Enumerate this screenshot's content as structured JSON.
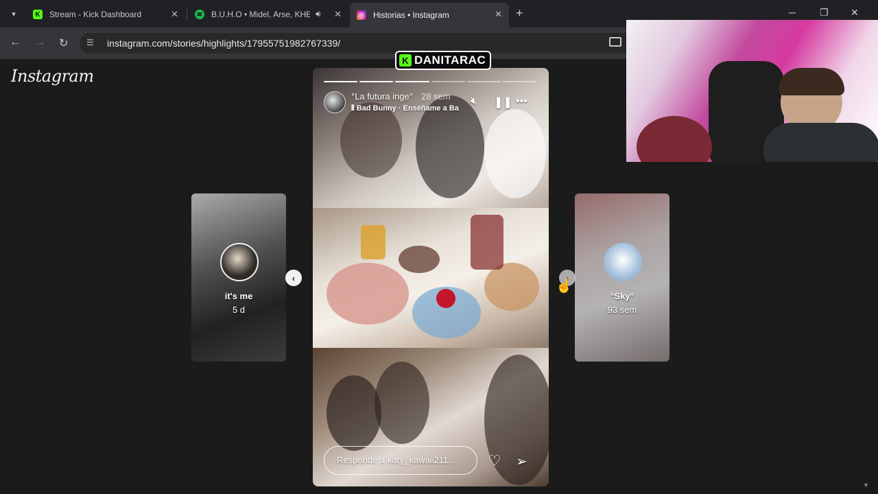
{
  "browser": {
    "tabs": [
      {
        "title": "Stream - Kick Dashboard",
        "icon": "kick-icon",
        "active": false
      },
      {
        "title": "B.U.H.O • Midel, Arse, KHEA",
        "icon": "spotify-icon",
        "active": false,
        "audio": true
      },
      {
        "title": "Historias • Instagram",
        "icon": "instagram-icon",
        "active": true
      }
    ],
    "new_tab_label": "+",
    "url": "instagram.com/stories/highlights/17955751982767339/"
  },
  "instagram": {
    "logo": "Instagram",
    "story": {
      "username": "°La futura inge°",
      "time": "28 sem",
      "music": "Bad Bunny · Enséñame a Ba",
      "reply_placeholder": "Responde a kary_kawaii211...",
      "segments_total": 6,
      "segments_viewed": 3
    },
    "prev_story": {
      "name": "it's me",
      "time": "5 d"
    },
    "next_story": {
      "name": "°Sky°",
      "time": "93 sem"
    }
  },
  "overlay": {
    "channel": "DANITARAC",
    "kick_color": "#53fc18"
  }
}
